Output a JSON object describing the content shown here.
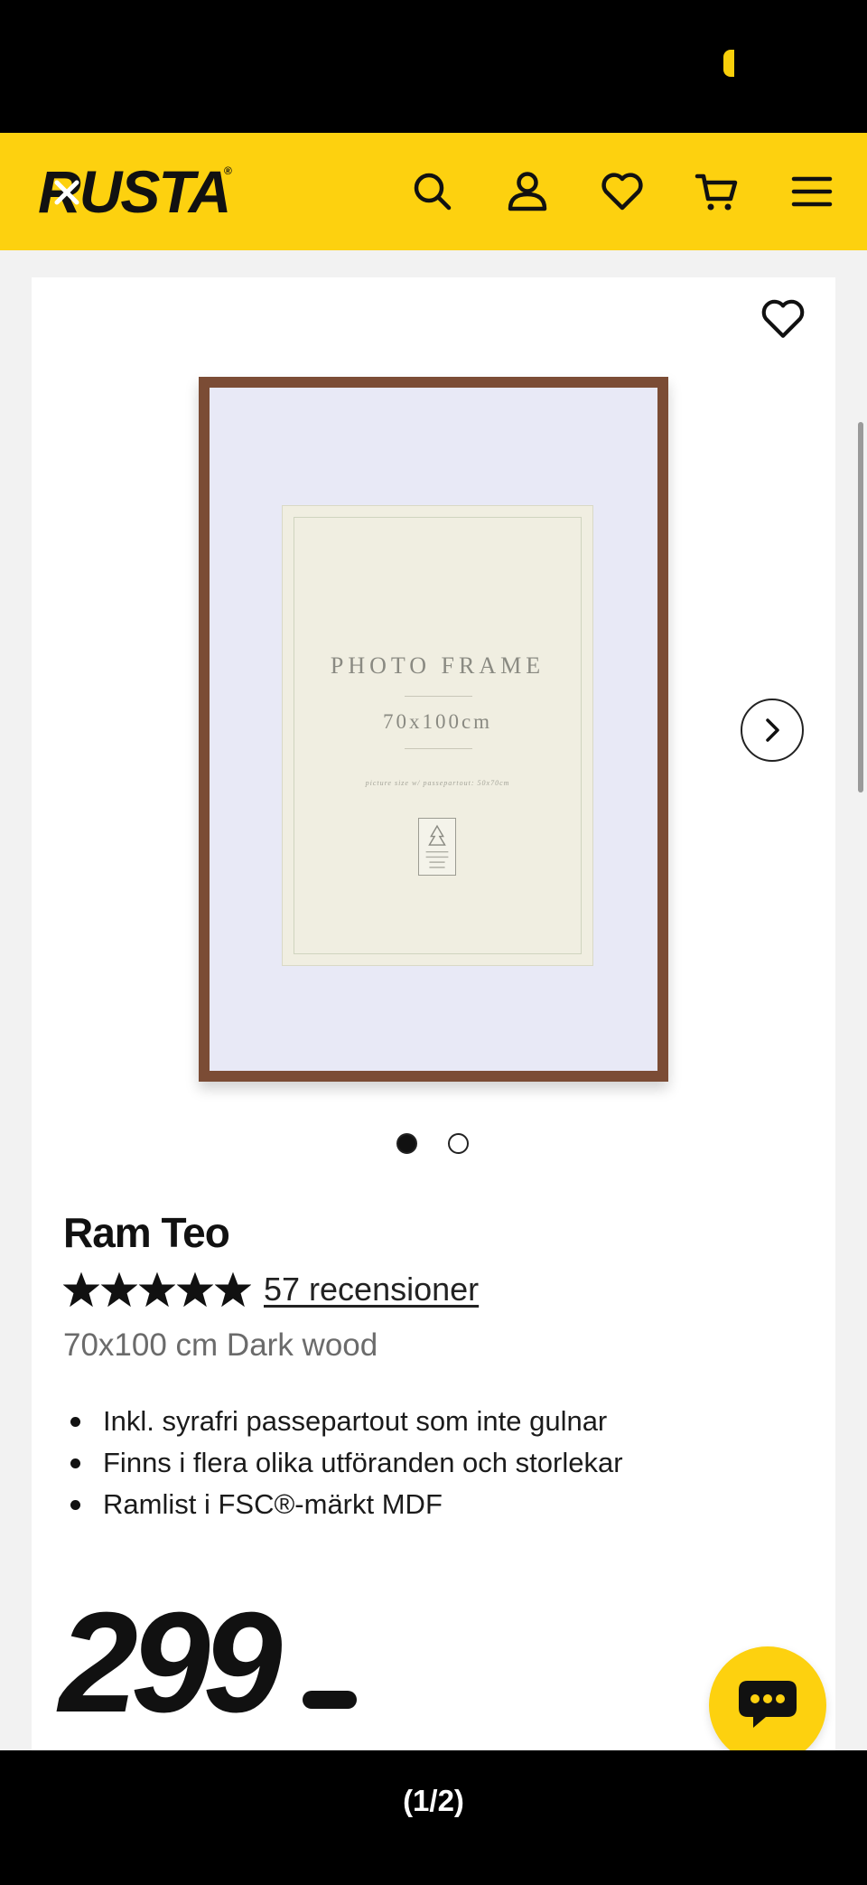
{
  "header": {
    "logo_text": "RUSTA",
    "logo_mark": "®",
    "icons": [
      "search-icon",
      "account-icon",
      "wishlist-icon",
      "cart-icon",
      "menu-icon"
    ]
  },
  "product": {
    "title": "Ram Teo",
    "rating": 5,
    "rating_max": 5,
    "reviews_link": "57 recensioner",
    "variant": "70x100 cm Dark wood",
    "features": [
      "Inkl. syrafri passepartout som inte gulnar",
      "Finns i flera olika utföranden och storlekar",
      "Ramlist i FSC®-märkt MDF"
    ],
    "price": "299",
    "image_text": {
      "title": "PHOTO FRAME",
      "size": "70x100cm",
      "small": "picture size w/ passepartout: 50x70cm"
    }
  },
  "gallery": {
    "images_total": 2,
    "active_index": 0
  },
  "viewer": {
    "page_counter": "(1/2)"
  },
  "colors": {
    "brand_yellow": "#fdd10f",
    "frame_wood": "#7b4c35",
    "text_dark": "#111111",
    "text_muted": "#6b6b6b"
  }
}
